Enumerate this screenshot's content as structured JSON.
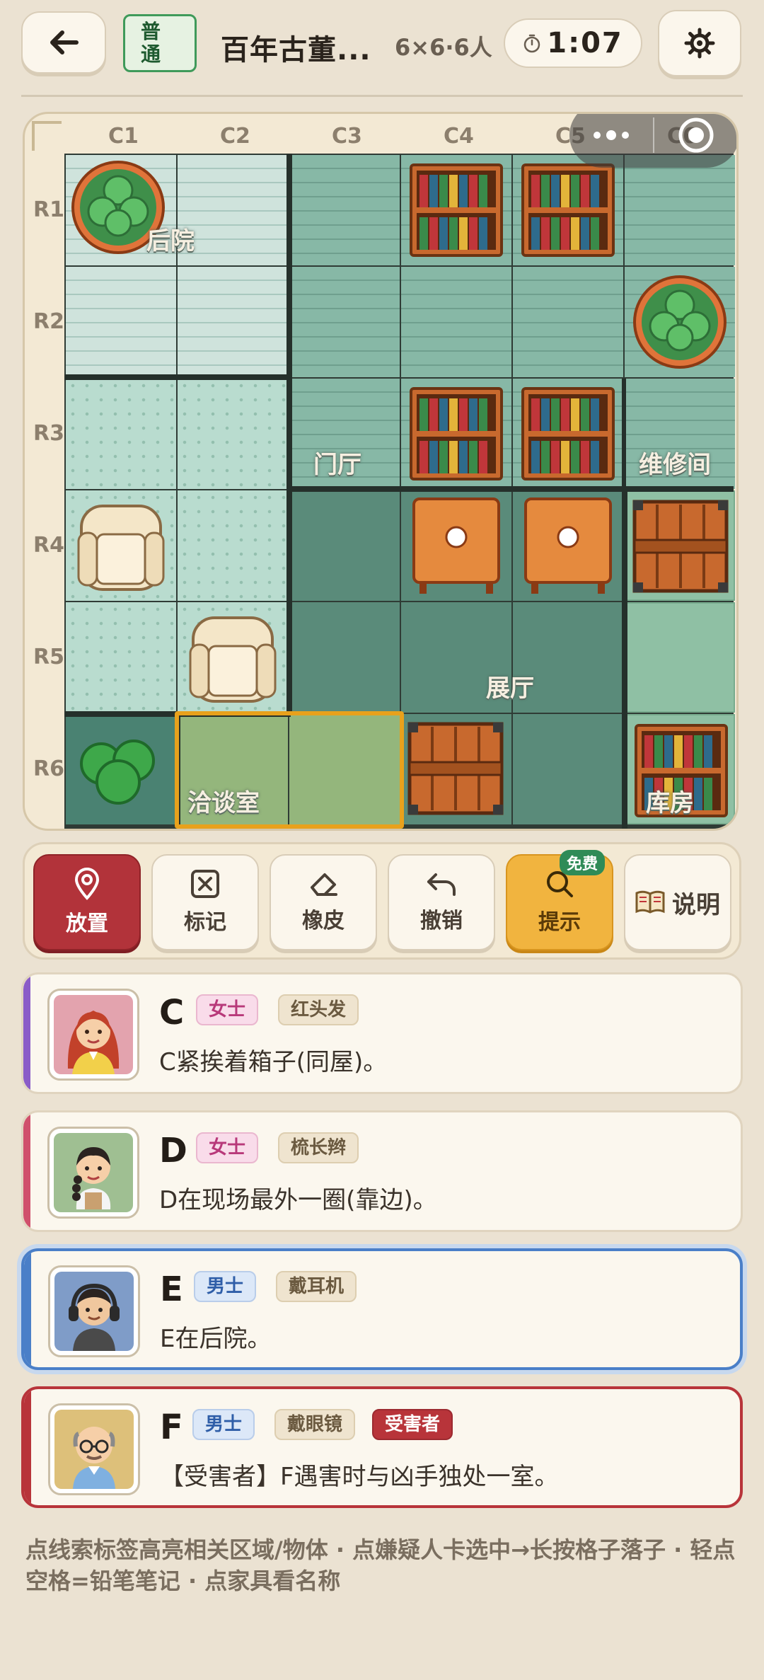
{
  "header": {
    "difficulty": "普通",
    "title": "百年古董...",
    "size_info": "6×6·6人",
    "timer": "1:07"
  },
  "board": {
    "columns": [
      "C1",
      "C2",
      "C3",
      "C4",
      "C5",
      "C6"
    ],
    "rows": [
      "R1",
      "R2",
      "R3",
      "R4",
      "R5",
      "R6"
    ],
    "rooms": {
      "backyard": "后院",
      "lobby": "门厅",
      "repair": "维修间",
      "hall": "展厅",
      "meeting": "洽谈室",
      "storage": "库房"
    },
    "selected_cells": [
      "R6C2",
      "R6C3"
    ]
  },
  "toolbar": {
    "place": "放置",
    "mark": "标记",
    "eraser": "橡皮",
    "undo": "撤销",
    "hint": "提示",
    "hint_badge": "免费",
    "help": "说明"
  },
  "suspects": [
    {
      "id": "C",
      "gender": "女士",
      "trait": "红头发",
      "clue": "C紧挨着箱子(同屋)。",
      "accent": "#8a5cc8"
    },
    {
      "id": "D",
      "gender": "女士",
      "trait": "梳长辫",
      "clue": "D在现场最外一圈(靠边)。",
      "accent": "#d0506c"
    },
    {
      "id": "E",
      "gender": "男士",
      "trait": "戴耳机",
      "clue": "E在后院。",
      "accent": "#4a7fc8"
    },
    {
      "id": "F",
      "gender": "男士",
      "trait": "戴眼镜",
      "victim_tag": "受害者",
      "clue": "【受害者】F遇害时与凶手独处一室。",
      "accent": "#b8343a"
    }
  ],
  "footer_note": "点线索标签高亮相关区域/物体 · 点嫌疑人卡选中→长按格子落子 · 轻点空格=铅笔笔记 · 点家具看名称"
}
